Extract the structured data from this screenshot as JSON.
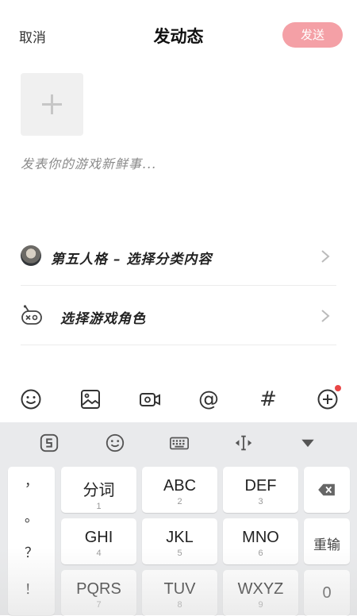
{
  "header": {
    "cancel_label": "取消",
    "title": "发动态",
    "send_label": "发送"
  },
  "composer": {
    "placeholder": "发表你的游戏新鲜事..."
  },
  "options": [
    {
      "label": "第五人格 – 选择分类内容"
    },
    {
      "label": "选择游戏角色"
    }
  ],
  "toolbar": {
    "icons": [
      "emoji-icon",
      "image-icon",
      "video-icon",
      "at-icon",
      "hashtag-icon",
      "add-circle-icon"
    ],
    "at_symbol": "@",
    "hash_symbol": "#"
  },
  "keyboard": {
    "top_icons": [
      "sogou-logo-icon",
      "emoji-icon",
      "keyboard-icon",
      "cursor-move-icon",
      "collapse-arrow-icon"
    ],
    "punct": [
      "，",
      "。",
      "？",
      "！"
    ],
    "keys": [
      {
        "main": "分词",
        "sub": "1"
      },
      {
        "main": "ABC",
        "sub": "2"
      },
      {
        "main": "DEF",
        "sub": "3"
      },
      {
        "main": "GHI",
        "sub": "4"
      },
      {
        "main": "JKL",
        "sub": "5"
      },
      {
        "main": "MNO",
        "sub": "6"
      },
      {
        "main": "PQRS",
        "sub": "7"
      },
      {
        "main": "TUV",
        "sub": "8"
      },
      {
        "main": "WXYZ",
        "sub": "9"
      }
    ],
    "reenter_label": "重输",
    "zero_label": "0"
  },
  "colors": {
    "send_bg": "#f4a0a6",
    "badge": "#e94646",
    "keyboard_bg": "#e9eaec"
  }
}
